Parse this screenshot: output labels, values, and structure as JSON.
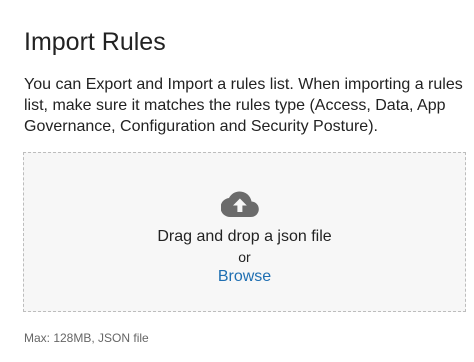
{
  "dialog": {
    "title": "Import Rules",
    "description": "You can Export and Import a rules list. When importing a rules list, make sure it matches the rules type (Access, Data, App Governance, Configuration and Security Posture)."
  },
  "dropzone": {
    "icon": "cloud-upload-icon",
    "drag_text": "Drag and drop a json file",
    "or_text": "or",
    "browse_label": "Browse"
  },
  "hint": "Max: 128MB, JSON file",
  "colors": {
    "link": "#1f6fb2",
    "icon": "#6b6b6b",
    "dropzone_bg": "#f7f7f7",
    "dropzone_border": "#bdbdbd",
    "hint_text": "#666666"
  }
}
